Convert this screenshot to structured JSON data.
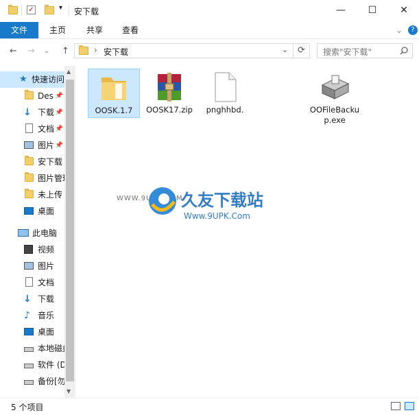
{
  "window": {
    "title": "安下载",
    "minimize": "—",
    "maximize": "☐",
    "close": "✕"
  },
  "ribbon": {
    "tabs": [
      "文件",
      "主页",
      "共享",
      "查看"
    ],
    "expand": "⌄",
    "help": "?"
  },
  "nav": {
    "back": "←",
    "forward": "→",
    "recent": "⌄",
    "up": "↑"
  },
  "address": {
    "path": "安下载",
    "separator": "›",
    "dropdown": "⌄",
    "refresh": "⟳"
  },
  "search": {
    "placeholder": "搜索\"安下载\"",
    "icon": "search-icon"
  },
  "sidebar": {
    "items": [
      {
        "label": "快速访问",
        "icon": "star-icon",
        "pinned": false,
        "selected": true
      },
      {
        "label": "Des",
        "icon": "folder-icon",
        "pinned": true
      },
      {
        "label": "下载",
        "icon": "download-icon",
        "pinned": true
      },
      {
        "label": "文档",
        "icon": "document-icon",
        "pinned": true
      },
      {
        "label": "图片",
        "icon": "picture-icon",
        "pinned": true
      },
      {
        "label": "安下载",
        "icon": "folder-icon",
        "pinned": false
      },
      {
        "label": "图片管理",
        "icon": "folder-icon",
        "pinned": false
      },
      {
        "label": "未上传",
        "icon": "folder-icon",
        "pinned": false
      },
      {
        "label": "桌面",
        "icon": "desktop-icon",
        "pinned": false
      },
      {
        "label": "此电脑",
        "icon": "computer-icon",
        "pinned": false
      },
      {
        "label": "视频",
        "icon": "video-icon",
        "pinned": false
      },
      {
        "label": "图片",
        "icon": "picture-icon",
        "pinned": false
      },
      {
        "label": "文档",
        "icon": "document-icon",
        "pinned": false
      },
      {
        "label": "下载",
        "icon": "download-icon",
        "pinned": false
      },
      {
        "label": "音乐",
        "icon": "music-icon",
        "pinned": false
      },
      {
        "label": "桌面",
        "icon": "desktop-icon",
        "pinned": false
      },
      {
        "label": "本地磁盘",
        "icon": "drive-icon",
        "pinned": false
      },
      {
        "label": "软件 (D",
        "icon": "drive-icon",
        "pinned": false
      },
      {
        "label": "备份[勿",
        "icon": "drive-icon",
        "pinned": false
      }
    ]
  },
  "files": [
    {
      "name": "OOSK.1.7",
      "type": "folder",
      "selected": true
    },
    {
      "name": "OOSK17.zip",
      "type": "archive"
    },
    {
      "name": "pnghhbd.",
      "type": "blank"
    },
    {
      "name": "OOFileBackup.exe",
      "type": "exe"
    }
  ],
  "watermark": {
    "url_left": "WWW.9UPK.COM",
    "brand": "久友下载站",
    "site": "Www.9UPK.Com"
  },
  "status": {
    "count": "5 个项目"
  },
  "colors": {
    "accent": "#1979ca",
    "selection": "#cce8ff",
    "folder": "#f3cf6b"
  }
}
